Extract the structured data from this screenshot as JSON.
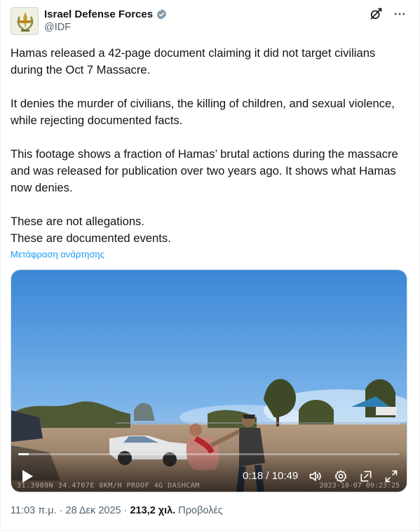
{
  "author": {
    "display_name": "Israel Defense Forces",
    "handle": "@IDF"
  },
  "icons": {
    "avatar": "idf-emblem-icon",
    "verified": "verified-badge-icon",
    "grok": "grok-icon",
    "more": "more-icon"
  },
  "post": {
    "paragraphs": [
      "Hamas released a 42-page document claiming it did not target civilians during the Oct 7 Massacre.",
      "It denies the murder of civilians, the killing of children, and sexual violence, while rejecting documented facts.",
      "This footage shows a fraction of Hamas’ brutal actions during the massacre and was released for publication over two years ago. It shows what Hamas now denies."
    ],
    "line1": "These are not allegations.",
    "line2": "These are documented events.",
    "translate_link": "Μετάφραση ανάρτησης"
  },
  "video": {
    "time": "0:18 / 10:49",
    "progress_fraction": 0.028,
    "dashcam_left": "31.3989N  34.4707E  0KM/H  PROOF 4G DASHCAM",
    "dashcam_right": "2023-10-07 09:23:25"
  },
  "meta": {
    "time_date": "11:03 π.μ. · 28 Δεκ 2025 · ",
    "views_count": "213,2 χιλ.",
    "views_label": " Προβολές"
  }
}
